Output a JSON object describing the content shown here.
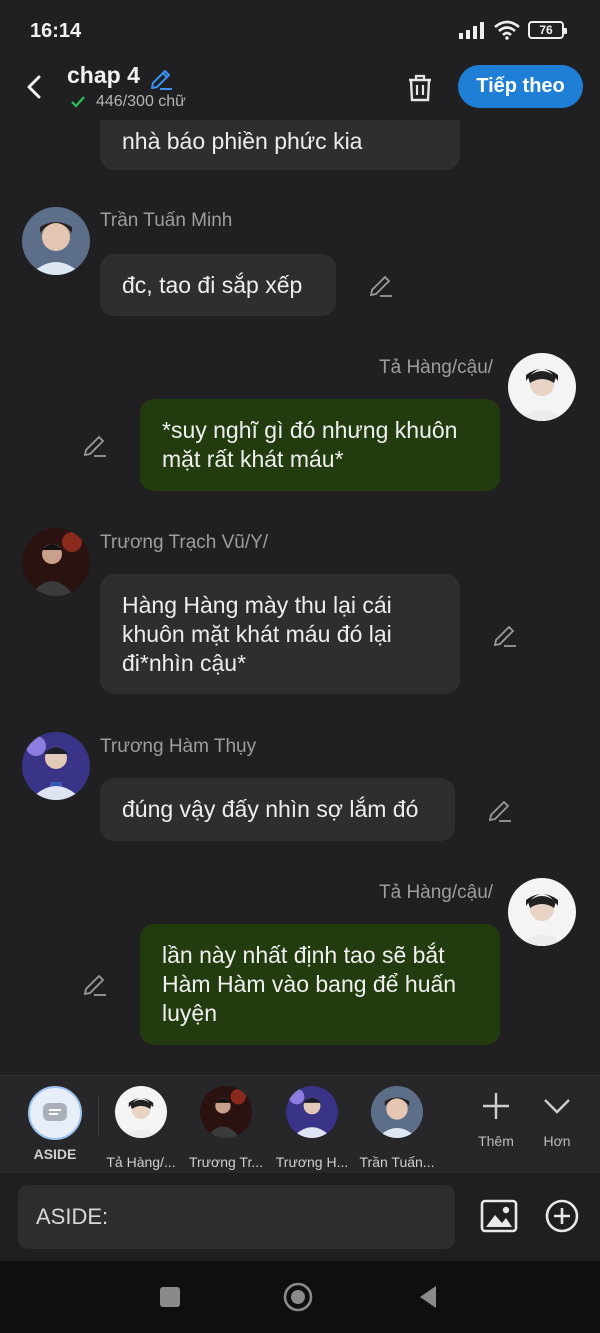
{
  "status": {
    "time": "16:14",
    "battery": "76"
  },
  "header": {
    "title": "chap 4",
    "word_count": "446/300 chữ",
    "next_label": "Tiếp theo"
  },
  "messages": [
    {
      "side": "left",
      "text": "nhà báo phiền phức kia"
    },
    {
      "side": "left",
      "name": "Trần Tuấn Minh",
      "avatar": "avatar-tran-tuan-minh",
      "text": "đc, tao đi sắp xếp"
    },
    {
      "side": "right",
      "name": "Tả Hàng/cậu/",
      "avatar": "avatar-ta-hang",
      "lines": [
        "*suy nghĩ gì đó nhưng khuôn",
        "mặt rất khát máu*"
      ]
    },
    {
      "side": "left",
      "name": "Trương Trạch Vũ/Y/",
      "avatar": "avatar-truong-trach-vu",
      "lines": [
        "Hàng Hàng mày thu lại cái",
        "khuôn mặt khát máu đó lại",
        "đi*nhìn cậu*"
      ]
    },
    {
      "side": "left",
      "name": "Trương Hàm Thụy",
      "avatar": "avatar-truong-ham-thuy",
      "text": "đúng vậy đấy nhìn sợ lắm đó"
    },
    {
      "side": "right",
      "name": "Tả Hàng/cậu/",
      "avatar": "avatar-ta-hang",
      "lines": [
        "lần này nhất định tao sẽ bắt",
        "Hàm Hàm vào bang để huấn",
        "luyện"
      ]
    }
  ],
  "characters": [
    {
      "label": "ASIDE",
      "selected": true
    },
    {
      "label": "Tả Hàng/..."
    },
    {
      "label": "Trương Tr..."
    },
    {
      "label": "Trương H..."
    },
    {
      "label": "Trần Tuấn..."
    }
  ],
  "tools": {
    "add_label": "Thêm",
    "more_label": "Hơn"
  },
  "input": {
    "placeholder": "ASIDE:"
  },
  "colors": {
    "accent": "#1f7fd6",
    "right_bubble": "#233c0f",
    "left_bubble": "#2e2e30",
    "background": "#202022"
  }
}
